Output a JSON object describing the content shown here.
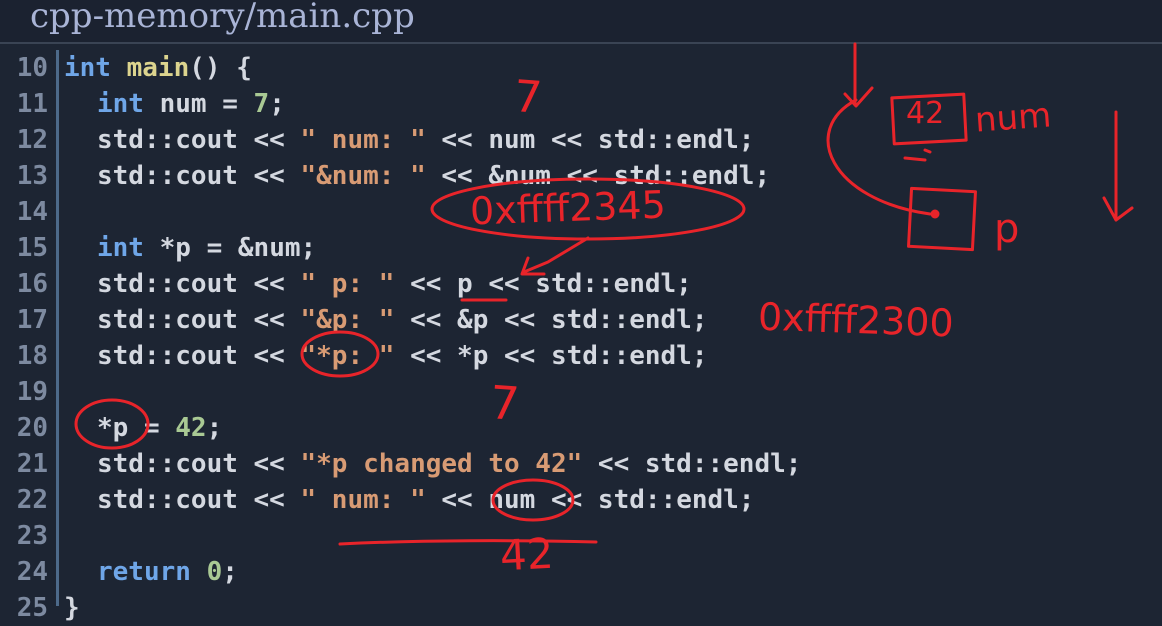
{
  "title": "cpp-memory/main.cpp",
  "lines": [
    {
      "n": "10",
      "tokens": [
        {
          "t": "int",
          "c": "kw"
        },
        {
          "t": " ",
          "c": "pl"
        },
        {
          "t": "main",
          "c": "fn"
        },
        {
          "t": "() {",
          "c": "pl"
        }
      ],
      "indent": 0
    },
    {
      "n": "11",
      "tokens": [
        {
          "t": "int",
          "c": "kw"
        },
        {
          "t": " num = ",
          "c": "pl"
        },
        {
          "t": "7",
          "c": "num"
        },
        {
          "t": ";",
          "c": "pl"
        }
      ],
      "indent": 1
    },
    {
      "n": "12",
      "tokens": [
        {
          "t": "std::cout << ",
          "c": "pl"
        },
        {
          "t": "\" num: \"",
          "c": "str"
        },
        {
          "t": " << num << std::endl;",
          "c": "pl"
        }
      ],
      "indent": 1
    },
    {
      "n": "13",
      "tokens": [
        {
          "t": "std::cout << ",
          "c": "pl"
        },
        {
          "t": "\"&num: \"",
          "c": "str"
        },
        {
          "t": " << &num << std::endl;",
          "c": "pl"
        }
      ],
      "indent": 1
    },
    {
      "n": "14",
      "tokens": [],
      "indent": 1
    },
    {
      "n": "15",
      "tokens": [
        {
          "t": "int",
          "c": "kw"
        },
        {
          "t": " *p = &num;",
          "c": "pl"
        }
      ],
      "indent": 1
    },
    {
      "n": "16",
      "tokens": [
        {
          "t": "std::cout << ",
          "c": "pl"
        },
        {
          "t": "\" p: \"",
          "c": "str"
        },
        {
          "t": " << p << std::endl;",
          "c": "pl"
        }
      ],
      "indent": 1
    },
    {
      "n": "17",
      "tokens": [
        {
          "t": "std::cout << ",
          "c": "pl"
        },
        {
          "t": "\"&p: \"",
          "c": "str"
        },
        {
          "t": " << &p << std::endl;",
          "c": "pl"
        }
      ],
      "indent": 1
    },
    {
      "n": "18",
      "tokens": [
        {
          "t": "std::cout << ",
          "c": "pl"
        },
        {
          "t": "\"*p: \"",
          "c": "str"
        },
        {
          "t": " << *p << std::endl;",
          "c": "pl"
        }
      ],
      "indent": 1
    },
    {
      "n": "19",
      "tokens": [],
      "indent": 1
    },
    {
      "n": "20",
      "tokens": [
        {
          "t": "*p = ",
          "c": "pl"
        },
        {
          "t": "42",
          "c": "num"
        },
        {
          "t": ";",
          "c": "pl"
        }
      ],
      "indent": 1
    },
    {
      "n": "21",
      "tokens": [
        {
          "t": "std::cout << ",
          "c": "pl"
        },
        {
          "t": "\"*p changed to 42\"",
          "c": "str"
        },
        {
          "t": " << std::endl;",
          "c": "pl"
        }
      ],
      "indent": 1
    },
    {
      "n": "22",
      "tokens": [
        {
          "t": "std::cout << ",
          "c": "pl"
        },
        {
          "t": "\" num: \"",
          "c": "str"
        },
        {
          "t": " << num << std::endl;",
          "c": "pl"
        }
      ],
      "indent": 1
    },
    {
      "n": "23",
      "tokens": [],
      "indent": 1
    },
    {
      "n": "24",
      "tokens": [
        {
          "t": "return",
          "c": "kw"
        },
        {
          "t": " ",
          "c": "pl"
        },
        {
          "t": "0",
          "c": "num"
        },
        {
          "t": ";",
          "c": "pl"
        }
      ],
      "indent": 1
    },
    {
      "n": "25",
      "tokens": [
        {
          "t": "}",
          "c": "pl"
        }
      ],
      "indent": 0
    }
  ],
  "annotations": {
    "ink_color": "#e8242a",
    "num_value_top": "7",
    "num_address": "0xffff2345",
    "p_address": "0xffff2300",
    "deref_value": "7",
    "num_changed": "42",
    "box_num_value": "42",
    "box_num_label": "num",
    "box_p_label": "p"
  }
}
